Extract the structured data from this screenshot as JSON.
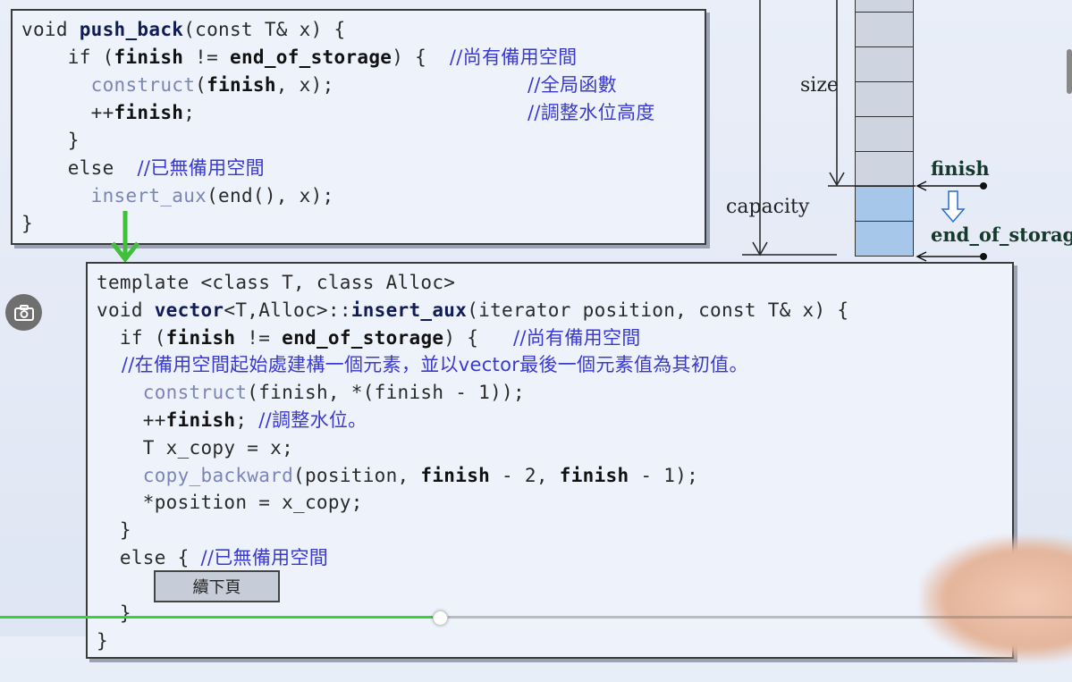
{
  "top_code": {
    "l1a": "void ",
    "l1b": "push_back",
    "l1c": "(const T& x) {",
    "l2a": "    if (",
    "l2b": "finish",
    "l2c": " != ",
    "l2d": "end_of_storage",
    "l2e": ") {  ",
    "l2cm": "//尚有備用空間",
    "l3a": "      ",
    "l3b": "construct",
    "l3c": "(",
    "l3d": "finish",
    "l3e": ", x);",
    "l3cm": "//全局函數",
    "l4a": "      ++",
    "l4b": "finish",
    "l4c": ";",
    "l4cm": "//調整水位高度",
    "l5": "    }",
    "l6a": "    else  ",
    "l6cm": "//已無備用空間",
    "l7a": "      ",
    "l7b": "insert_aux",
    "l7c": "(end(), x);",
    "l8": "}"
  },
  "bottom_code": {
    "l1": "template <class T, class Alloc>",
    "l2a": "void ",
    "l2b": "vector",
    "l2c": "<T,Alloc>::",
    "l2d": "insert_aux",
    "l2e": "(iterator position, const T& x) {",
    "l3a": "  if (",
    "l3b": "finish",
    "l3c": " != ",
    "l3d": "end_of_storage",
    "l3e": ") {   ",
    "l3cm": "//尚有備用空間",
    "l4cm": "    //在備用空間起始處建構一個元素，並以vector最後一個元素值為其初值。",
    "l5a": "    ",
    "l5b": "construct",
    "l5c": "(finish, *(finish - 1));",
    "l6a": "    ++",
    "l6b": "finish",
    "l6c": "; ",
    "l6cm": "//調整水位。",
    "l7": "    T x_copy = x;",
    "l8a": "    ",
    "l8b": "copy_backward",
    "l8c": "(position, ",
    "l8d": "finish",
    "l8e": " - 2, ",
    "l8f": "finish",
    "l8g": " - 1);",
    "l9": "    *position = x_copy;",
    "l10": "  }",
    "l11a": "  else { ",
    "l11cm": "//已無備用空間",
    "l13": "  }",
    "l14": "}"
  },
  "diagram": {
    "size_label": "size",
    "capacity_label": "capacity",
    "finish_label": "finish",
    "end_of_storage_label": "end_of_storag"
  },
  "next_page_button": "續下頁",
  "player": {
    "progress_fraction": 0.41
  },
  "icons": {
    "camera": "camera-icon"
  },
  "colors": {
    "comment": "#3a3ad0",
    "progress": "#3ad13a",
    "slot_used": "#cfd5e0",
    "slot_free": "#a6c6ea"
  }
}
